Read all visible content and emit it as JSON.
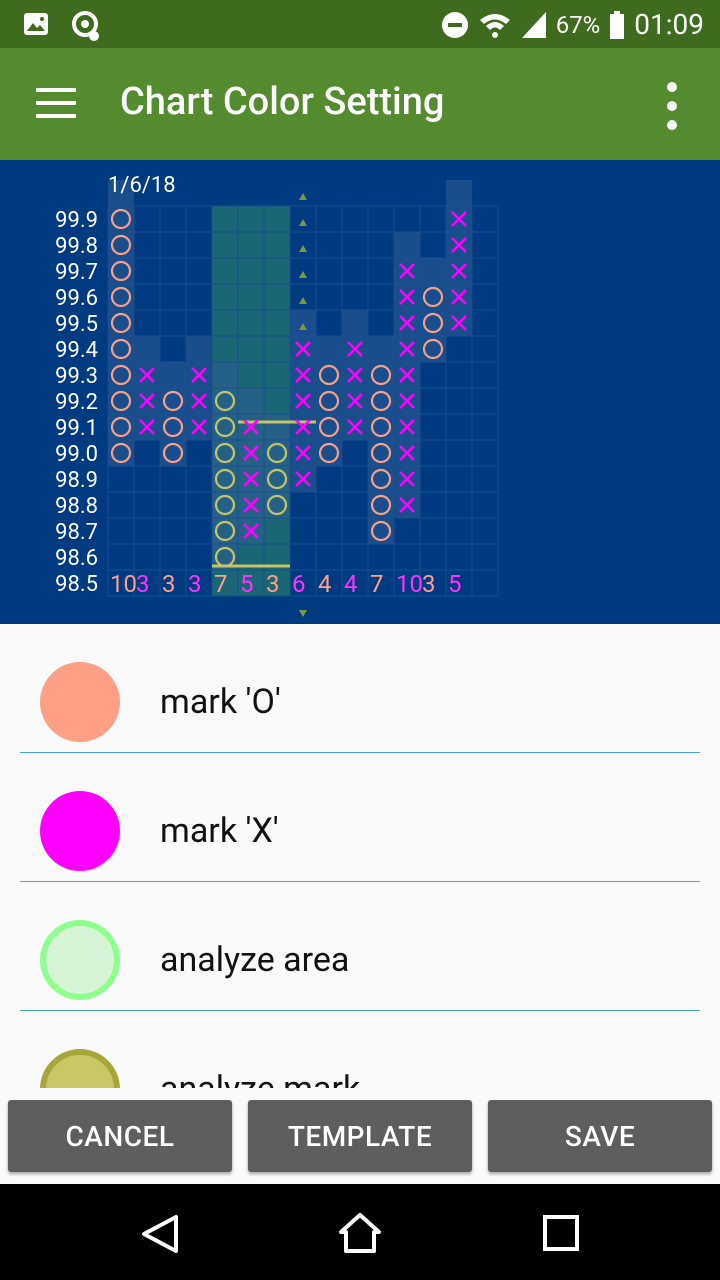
{
  "status": {
    "battery": "67%",
    "time": "01:09",
    "left_icons": [
      "image-icon",
      "sync-icon"
    ],
    "right_icons": [
      "dnd-icon",
      "wifi-icon",
      "signal-icon",
      "battery-icon"
    ]
  },
  "app_bar": {
    "title": "Chart Color Setting",
    "menu_icon": "hamburger-menu-icon",
    "overflow_icon": "overflow-menu-icon",
    "color": "#558b2f"
  },
  "chart": {
    "date": "1/6/18",
    "price_labels": [
      "99.9",
      "99.8",
      "99.7",
      "99.6",
      "99.5",
      "99.4",
      "99.3",
      "99.2",
      "99.1",
      "99.0",
      "98.9",
      "98.8",
      "98.7",
      "98.6",
      "98.5"
    ],
    "column_counts": [
      "10",
      "3",
      "3",
      "3",
      "7",
      "5",
      "3",
      "6",
      "4",
      "4",
      "7",
      "10",
      "3",
      "5"
    ],
    "columns": [
      {
        "type": "O",
        "top": "99.9",
        "bottom": "99.0"
      },
      {
        "type": "X",
        "top": "99.3",
        "bottom": "99.1"
      },
      {
        "type": "O",
        "top": "99.2",
        "bottom": "99.0"
      },
      {
        "type": "X",
        "top": "99.3",
        "bottom": "99.1"
      },
      {
        "type": "O",
        "top": "99.2",
        "bottom": "98.6"
      },
      {
        "type": "X",
        "top": "99.1",
        "bottom": "98.7"
      },
      {
        "type": "O",
        "top": "99.0",
        "bottom": "98.8"
      },
      {
        "type": "X",
        "top": "99.4",
        "bottom": "98.9"
      },
      {
        "type": "O",
        "top": "99.3",
        "bottom": "99.0"
      },
      {
        "type": "X",
        "top": "99.4",
        "bottom": "99.1"
      },
      {
        "type": "O",
        "top": "99.3",
        "bottom": "98.7"
      },
      {
        "type": "X",
        "top": "99.7",
        "bottom": "98.8"
      },
      {
        "type": "O",
        "top": "99.6",
        "bottom": "99.4"
      },
      {
        "type": "X",
        "top": "99.9",
        "bottom": "99.5"
      }
    ],
    "colors": {
      "background": "#003a80",
      "mark_o": "#f7a089",
      "mark_x": "#ff00ff",
      "analyze_area": "#2e8b6a",
      "analyze_mark": "#c6c464",
      "grid": "#1a4f8e",
      "label": "#ffffff",
      "count_odd": "#ff9f8c",
      "count_even": "#ff33ff"
    }
  },
  "settings": [
    {
      "label": "mark 'O'",
      "color": "#ff9f85",
      "ring": "#ff9f85"
    },
    {
      "label": "mark 'X'",
      "color": "#ff00ff",
      "ring": "#ff00ff"
    },
    {
      "label": "analyze area",
      "color": "#d6f5d6",
      "ring": "#8cff8c"
    },
    {
      "label": "analyze mark",
      "color": "#c8c866",
      "ring": "#a8a83a"
    }
  ],
  "buttons": {
    "cancel": "CANCEL",
    "template": "TEMPLATE",
    "save": "SAVE"
  },
  "nav": {
    "back_icon": "back-triangle-icon",
    "home_icon": "home-icon",
    "recents_icon": "recents-square-icon"
  }
}
